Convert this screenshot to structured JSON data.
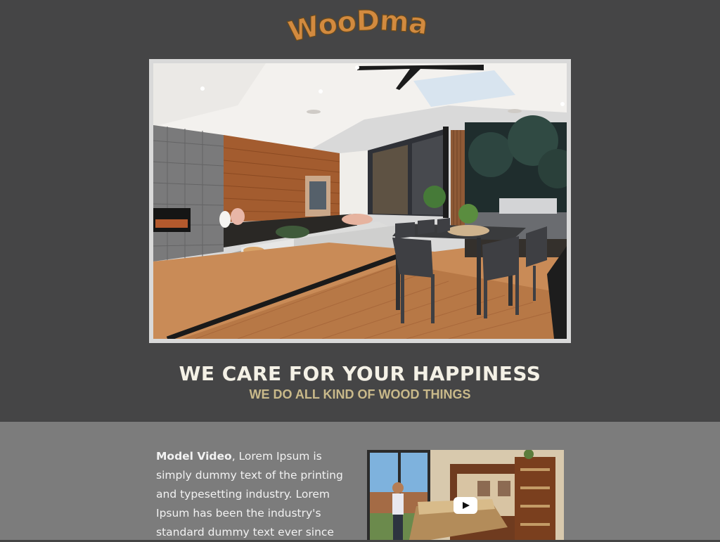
{
  "brand": {
    "logo_text": "WooDmart",
    "logo_color": "#d28a3f"
  },
  "hero": {
    "image": "living room with open sliding doors to outdoor dining deck"
  },
  "headline": {
    "title": "WE CARE FOR YOUR HAPPINESS",
    "subtitle": "WE DO ALL KIND OF WOOD THINGS"
  },
  "content": {
    "lead_bold": "Model Video",
    "body": ", Lorem Ipsum is simply dummy text of the printing and typesetting industry. Lorem Ipsum has been the industry's standard dummy text ever since"
  },
  "video": {
    "thumbnail": "woman pulling down a wooden murphy bed",
    "play_icon": "play-icon"
  },
  "colors": {
    "top_bg": "#454546",
    "bottom_bg": "#7c7c7c",
    "title": "#f4f1e6",
    "subtitle": "#c9b98a"
  }
}
